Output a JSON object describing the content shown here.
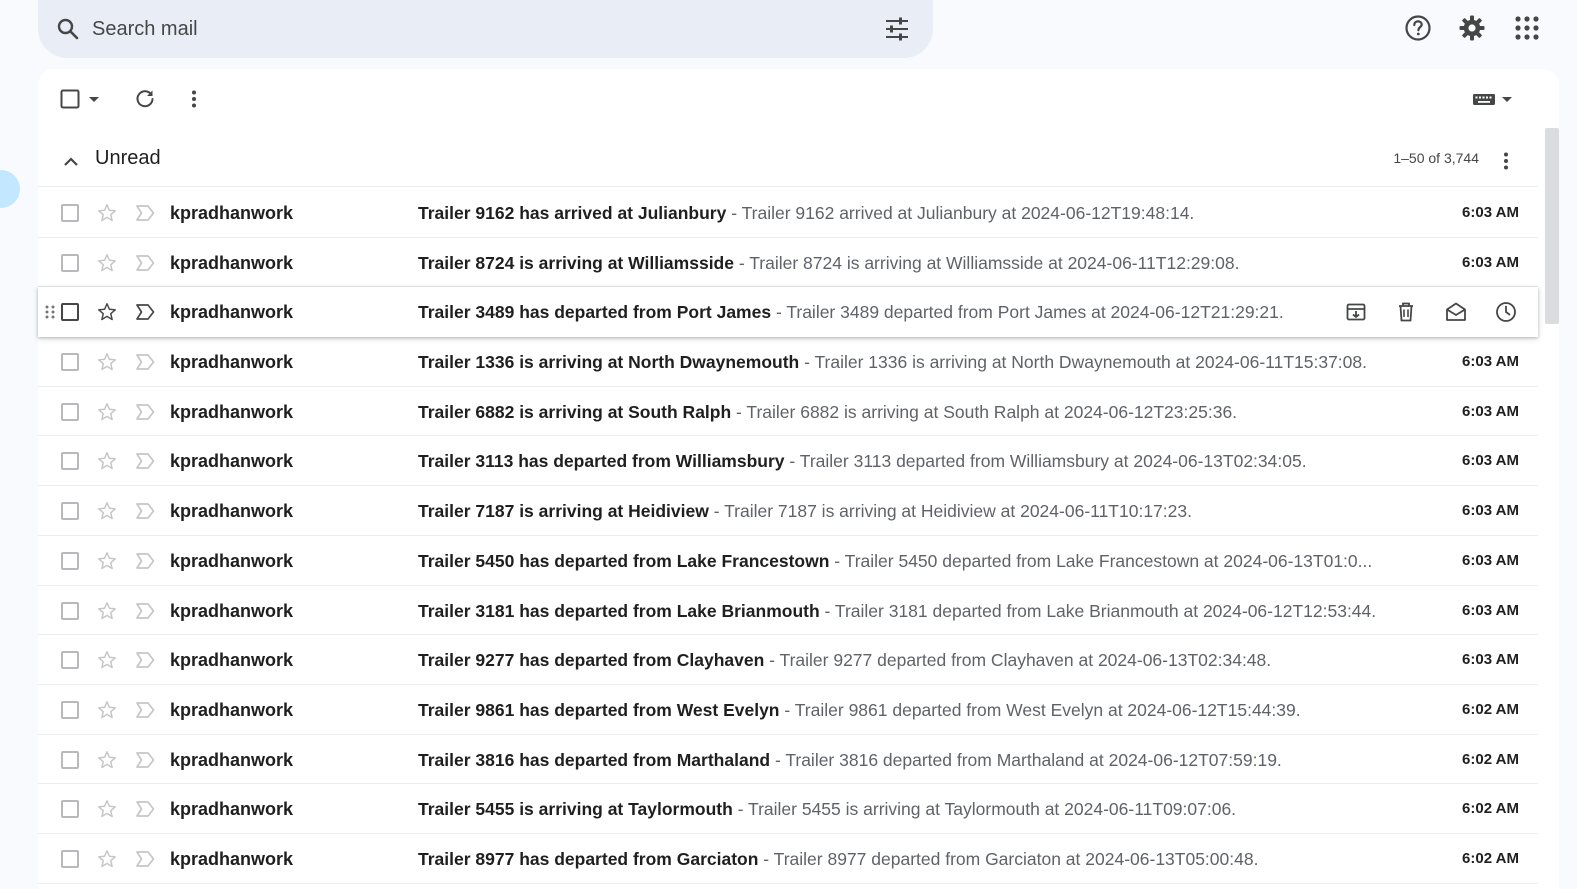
{
  "search": {
    "placeholder": "Search mail"
  },
  "section": {
    "title": "Unread",
    "count": "1–50 of 3,744"
  },
  "emails": [
    {
      "sender": "kpradhanwork",
      "subject": "Trailer 9162 has arrived at Julianbury",
      "snippet": "Trailer 9162 arrived at Julianbury at 2024-06-12T19:48:14.",
      "time": "6:03 AM"
    },
    {
      "sender": "kpradhanwork",
      "subject": "Trailer 8724 is arriving at Williamsside",
      "snippet": "Trailer 8724 is arriving at Williamsside at 2024-06-11T12:29:08.",
      "time": "6:03 AM"
    },
    {
      "sender": "kpradhanwork",
      "subject": "Trailer 3489 has departed from Port James",
      "snippet": "Trailer 3489 departed from Port James at 2024-06-12T21:29:21.",
      "time": "6:03 AM"
    },
    {
      "sender": "kpradhanwork",
      "subject": "Trailer 1336 is arriving at North Dwaynemouth",
      "snippet": "Trailer 1336 is arriving at North Dwaynemouth at 2024-06-11T15:37:08.",
      "time": "6:03 AM"
    },
    {
      "sender": "kpradhanwork",
      "subject": "Trailer 6882 is arriving at South Ralph",
      "snippet": "Trailer 6882 is arriving at South Ralph at 2024-06-12T23:25:36.",
      "time": "6:03 AM"
    },
    {
      "sender": "kpradhanwork",
      "subject": "Trailer 3113 has departed from Williamsbury",
      "snippet": "Trailer 3113 departed from Williamsbury at 2024-06-13T02:34:05.",
      "time": "6:03 AM"
    },
    {
      "sender": "kpradhanwork",
      "subject": "Trailer 7187 is arriving at Heidiview",
      "snippet": "Trailer 7187 is arriving at Heidiview at 2024-06-11T10:17:23.",
      "time": "6:03 AM"
    },
    {
      "sender": "kpradhanwork",
      "subject": "Trailer 5450 has departed from Lake Francestown",
      "snippet": "Trailer 5450 departed from Lake Francestown at 2024-06-13T01:0...",
      "time": "6:03 AM"
    },
    {
      "sender": "kpradhanwork",
      "subject": "Trailer 3181 has departed from Lake Brianmouth",
      "snippet": "Trailer 3181 departed from Lake Brianmouth at 2024-06-12T12:53:44.",
      "time": "6:03 AM"
    },
    {
      "sender": "kpradhanwork",
      "subject": "Trailer 9277 has departed from Clayhaven",
      "snippet": "Trailer 9277 departed from Clayhaven at 2024-06-13T02:34:48.",
      "time": "6:03 AM"
    },
    {
      "sender": "kpradhanwork",
      "subject": "Trailer 9861 has departed from West Evelyn",
      "snippet": "Trailer 9861 departed from West Evelyn at 2024-06-12T15:44:39.",
      "time": "6:02 AM"
    },
    {
      "sender": "kpradhanwork",
      "subject": "Trailer 3816 has departed from Marthaland",
      "snippet": "Trailer 3816 departed from Marthaland at 2024-06-12T07:59:19.",
      "time": "6:02 AM"
    },
    {
      "sender": "kpradhanwork",
      "subject": "Trailer 5455 is arriving at Taylormouth",
      "snippet": "Trailer 5455 is arriving at Taylormouth at 2024-06-11T09:07:06.",
      "time": "6:02 AM"
    },
    {
      "sender": "kpradhanwork",
      "subject": "Trailer 8977 has departed from Garciaton",
      "snippet": "Trailer 8977 departed from Garciaton at 2024-06-13T05:00:48.",
      "time": "6:02 AM"
    }
  ],
  "hover_row_index": 2,
  "icons": {
    "search": "search-icon",
    "tune": "tune-icon",
    "help": "help-icon",
    "settings": "gear-icon",
    "apps": "apps-grid-icon",
    "select": "checkbox-icon",
    "refresh": "refresh-icon",
    "more": "more-vert-icon",
    "input_tools": "keyboard-icon",
    "star": "star-icon",
    "important": "important-icon",
    "archive": "archive-icon",
    "delete": "trash-icon",
    "mark_read": "mark-read-icon",
    "snooze": "snooze-icon"
  },
  "colors": {
    "background": "#f8fafd",
    "search_bg": "#e9eef6",
    "selected_nav": "#c2e7ff",
    "text": "#1f1f1f",
    "snippet": "#5f6368"
  }
}
